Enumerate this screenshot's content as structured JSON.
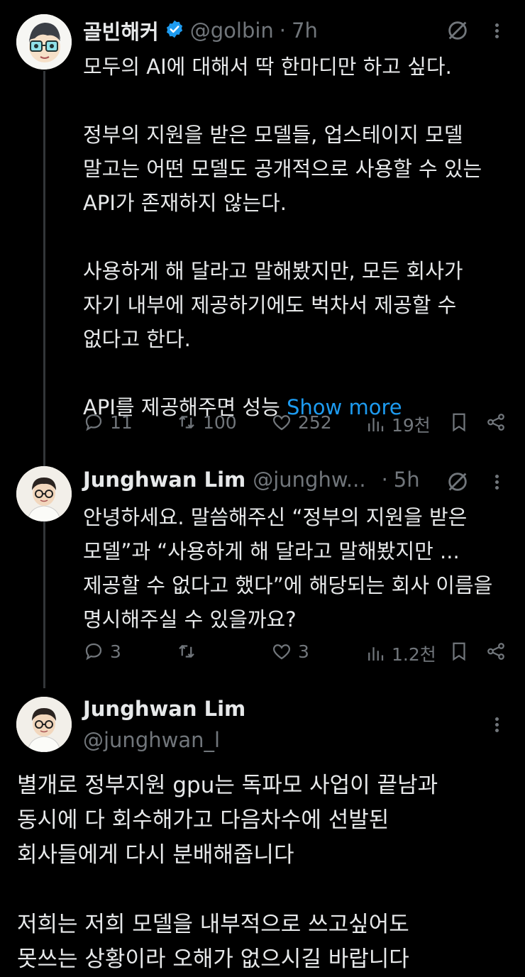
{
  "tweet1": {
    "name": "골빈해커",
    "handle": "@golbin",
    "sep": "·",
    "time": "7h",
    "body": "모두의 AI에 대해서 딱 한마디만 하고 싶다.\n\n정부의 지원을 받은 모델들, 업스테이지 모델\n말고는 어떤 모델도 공개적으로 사용할 수 있는\nAPI가 존재하지 않는다.\n\n사용하게 해 달라고 말해봤지만, 모든 회사가\n자기 내부에 제공하기에도 벅차서 제공할 수\n없다고 한다.\n\nAPI를 제공해주면 성능 ",
    "show_more": "Show more",
    "replies": "11",
    "reposts": "100",
    "likes": "252",
    "views": "19천"
  },
  "tweet2": {
    "name": "Junghwan Lim",
    "handle": "@junghw...",
    "sep": "·",
    "time": "5h",
    "body": "안녕하세요. 말씀해주신 “정부의 지원을 받은\n모델”과 “사용하게 해 달라고 말해봤지만 ...\n제공할 수 없다고 했다”에 해당되는 회사 이름을\n명시해주실 수 있을까요?",
    "replies": "3",
    "reposts": "",
    "likes": "3",
    "views": "1.2천"
  },
  "tweet3": {
    "name": "Junghwan Lim",
    "handle": "@junghwan_l",
    "body": "별개로 정부지원 gpu는 독파모 사업이 끝남과\n동시에 다 회수해가고 다음차수에 선발된\n회사들에게 다시 분배해줍니다\n\n저희는 저희 모델을 내부적으로 쓰고싶어도\n못쓰는 상황이라 오해가 없으시길 바랍니다"
  },
  "colors": {
    "background": "#000000",
    "text": "#e7e9ea",
    "muted": "#71767b",
    "accent": "#1d9bf0"
  },
  "icons": [
    "grok-icon",
    "more-icon",
    "reply-icon",
    "repost-icon",
    "like-icon",
    "views-icon",
    "bookmark-icon",
    "share-icon",
    "verified-badge-icon"
  ]
}
